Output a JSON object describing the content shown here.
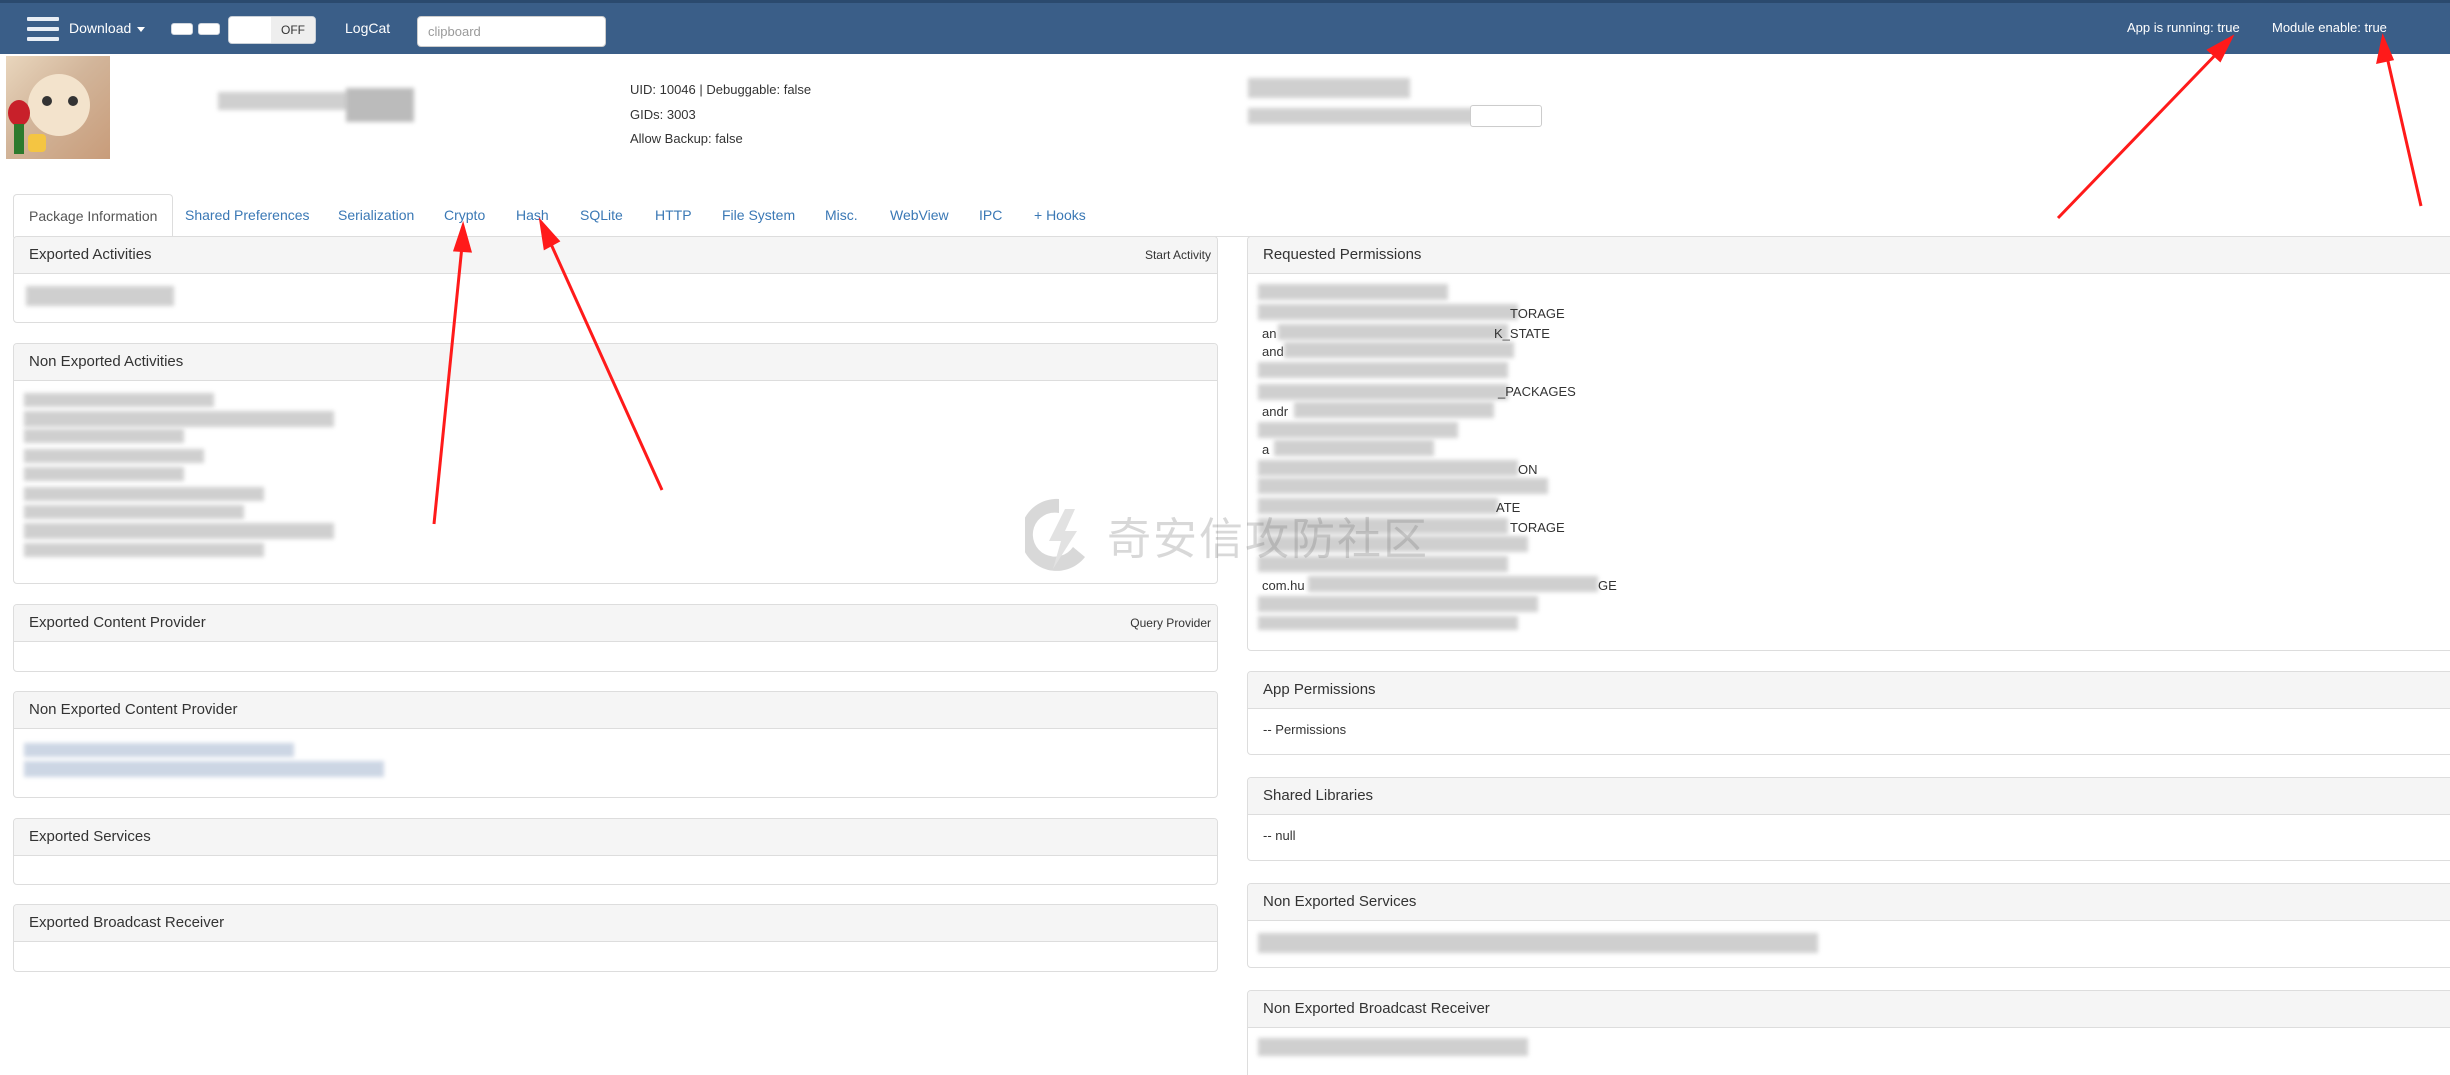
{
  "navbar": {
    "download_label": "Download",
    "toggle_off_label": "OFF",
    "logcat_label": "LogCat",
    "search_placeholder": "clipboard",
    "app_running": "App is running: true",
    "module_enable": "Module enable: true",
    "bg_color": "#3a5e88"
  },
  "header": {
    "uid_line": "UID: 10046 | Debuggable: false",
    "gids_line": "GIDs: 3003",
    "backup_line": "Allow Backup: false"
  },
  "tabs": [
    {
      "label": "Package Information"
    },
    {
      "label": "Shared Preferences"
    },
    {
      "label": "Serialization"
    },
    {
      "label": "Crypto"
    },
    {
      "label": "Hash"
    },
    {
      "label": "SQLite"
    },
    {
      "label": "HTTP"
    },
    {
      "label": "File System"
    },
    {
      "label": "Misc."
    },
    {
      "label": "WebView"
    },
    {
      "label": "IPC"
    },
    {
      "label": "+ Hooks"
    }
  ],
  "panels": {
    "exported_activities": {
      "title": "Exported Activities",
      "action": "Start Activity"
    },
    "non_exported_activities": {
      "title": "Non Exported Activities"
    },
    "exported_content_provider": {
      "title": "Exported Content Provider",
      "action": "Query Provider"
    },
    "non_exported_content_provider": {
      "title": "Non Exported Content Provider"
    },
    "exported_services": {
      "title": "Exported Services"
    },
    "exported_broadcast_receiver": {
      "title": "Exported Broadcast Receiver"
    },
    "requested_permissions": {
      "title": "Requested Permissions",
      "visible_fragments": [
        "TORAGE",
        "an",
        "K_STATE",
        "and",
        "_PACKAGES",
        "andr",
        "a",
        "ON",
        "ATE",
        "TORAGE",
        "com.hu",
        "GE"
      ]
    },
    "app_permissions": {
      "title": "App Permissions",
      "body": "-- Permissions"
    },
    "shared_libraries": {
      "title": "Shared Libraries",
      "body": "-- null"
    },
    "non_exported_services": {
      "title": "Non Exported Services"
    },
    "non_exported_broadcast_receiver": {
      "title": "Non Exported Broadcast Receiver"
    }
  },
  "watermark": {
    "text": "奇安信攻防社区"
  },
  "annotation_color": "#ff1a1a"
}
